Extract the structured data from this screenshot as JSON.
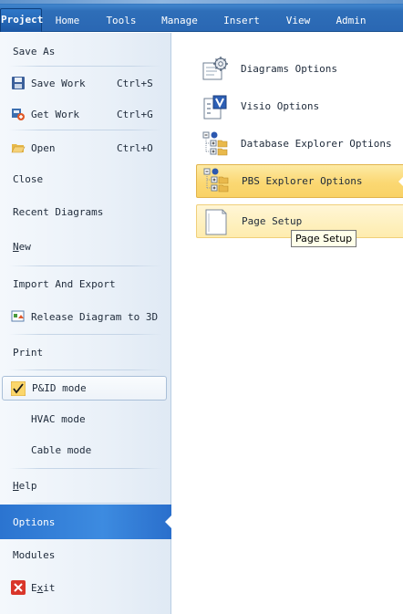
{
  "ribbon": {
    "tabs": [
      "Project",
      "Home",
      "Tools",
      "Manage",
      "Insert",
      "View",
      "Admin"
    ]
  },
  "menu": {
    "save_as": "Save As",
    "save_work": "Save Work",
    "save_work_shortcut": "Ctrl+S",
    "get_work": "Get Work",
    "get_work_shortcut": "Ctrl+G",
    "open": "Open",
    "open_shortcut": "Ctrl+O",
    "close": "Close",
    "recent_diagrams": "Recent Diagrams",
    "new_first": "N",
    "new_rest": "ew",
    "import_export": "Import And Export",
    "release_3d": "Release Diagram to 3D",
    "print": "Print",
    "pid_mode": "P&ID mode",
    "hvac_mode": "HVAC mode",
    "cable_mode": "Cable mode",
    "help_first": "H",
    "help_rest": "elp",
    "options": "Options",
    "modules": "Modules",
    "exit_first": "E",
    "exit_mid": "x",
    "exit_rest": "it"
  },
  "options_pane": {
    "diagrams_options": "Diagrams Options",
    "visio_options": "Visio Options",
    "database_explorer_options": "Database Explorer Options",
    "pbs_explorer_options": "PBS Explorer Options",
    "page_setup": "Page Setup"
  },
  "tooltip": {
    "text": "Page Setup"
  }
}
